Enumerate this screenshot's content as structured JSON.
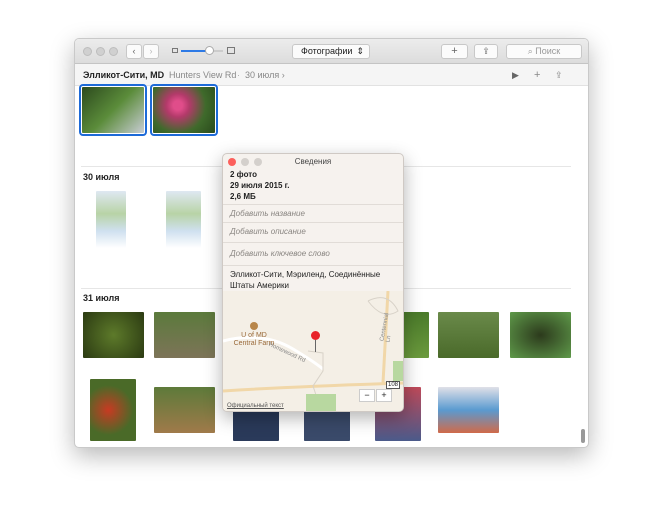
{
  "toolbar": {
    "view_select": "Фотографии",
    "add": "+",
    "search_placeholder": "Поиск"
  },
  "breadcrumb": {
    "place": "Элликот-Сити, MD",
    "street": "Hunters View Rd",
    "sep": "·",
    "date": "30 июля ›"
  },
  "sections": [
    {
      "title": "30 июля"
    },
    {
      "title": "31 июля"
    }
  ],
  "info": {
    "title": "Сведения",
    "count": "2 фото",
    "date": "29 июля 2015 г.",
    "size": "2,6 МБ",
    "add_title": "Добавить название",
    "add_description": "Добавить описание",
    "add_keyword": "Добавить ключевое слово",
    "location": "Элликот-Сити, Мэриленд, Соединённые Штаты Америки",
    "map": {
      "poi": "U of MD Central Farm",
      "road1": "Homewood Rd",
      "road2": "Centennial Ln",
      "route": "108",
      "legal": "Официальный текст",
      "zoom_out": "−",
      "zoom_in": "+"
    }
  },
  "colors": {
    "accent": "#1d6ad8",
    "close": "#fc605c"
  }
}
